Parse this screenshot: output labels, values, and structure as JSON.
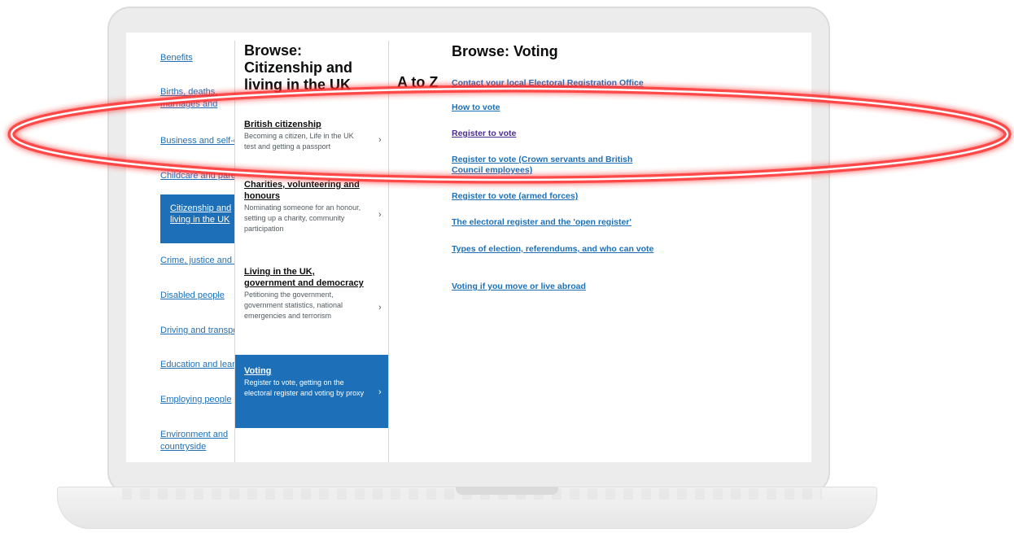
{
  "sidebar": {
    "items": [
      {
        "label": "Benefits"
      },
      {
        "label": "Births, deaths, marriages and care"
      },
      {
        "label": "Business and self-employed"
      },
      {
        "label": "Childcare and parenting"
      },
      {
        "label": "Citizenship and living in the UK"
      },
      {
        "label": "Crime, justice and the law"
      },
      {
        "label": "Disabled people"
      },
      {
        "label": "Driving and transport"
      },
      {
        "label": "Education and learning"
      },
      {
        "label": "Employing people"
      },
      {
        "label": "Environment and countryside"
      }
    ]
  },
  "browse_citizenship": {
    "title": "Browse: Citizenship and living in the UK",
    "topics": [
      {
        "title": "British citizenship",
        "desc": "Becoming a citizen, Life in the UK test and getting a passport"
      },
      {
        "title": "Charities, volunteering and honours",
        "desc": "Nominating someone for an honour, setting up a charity, community participation"
      },
      {
        "title": "Living in the UK, government and democracy",
        "desc": "Petitioning the government, government statistics, national emergencies and terrorism"
      },
      {
        "title": "Voting",
        "desc": "Register to vote, getting on the electoral register and voting by proxy"
      }
    ]
  },
  "atoz_label": "A to Z",
  "browse_voting": {
    "title": "Browse: Voting",
    "links": [
      {
        "label": "Contact your local Electoral Registration Office"
      },
      {
        "label": "How to vote"
      },
      {
        "label": "Register to vote"
      },
      {
        "label": "Register to vote (Crown servants and British Council employees)"
      },
      {
        "label": "Register to vote (armed forces)"
      },
      {
        "label": "The electoral register and the 'open register'"
      },
      {
        "label": "Types of election, referendums, and who can vote"
      },
      {
        "label": "Voting if you move or live abroad"
      }
    ]
  },
  "colors": {
    "link": "#1d70b8",
    "visited": "#4c2c92",
    "text": "#0b0c0c",
    "annotation": "#ff2a2a"
  }
}
